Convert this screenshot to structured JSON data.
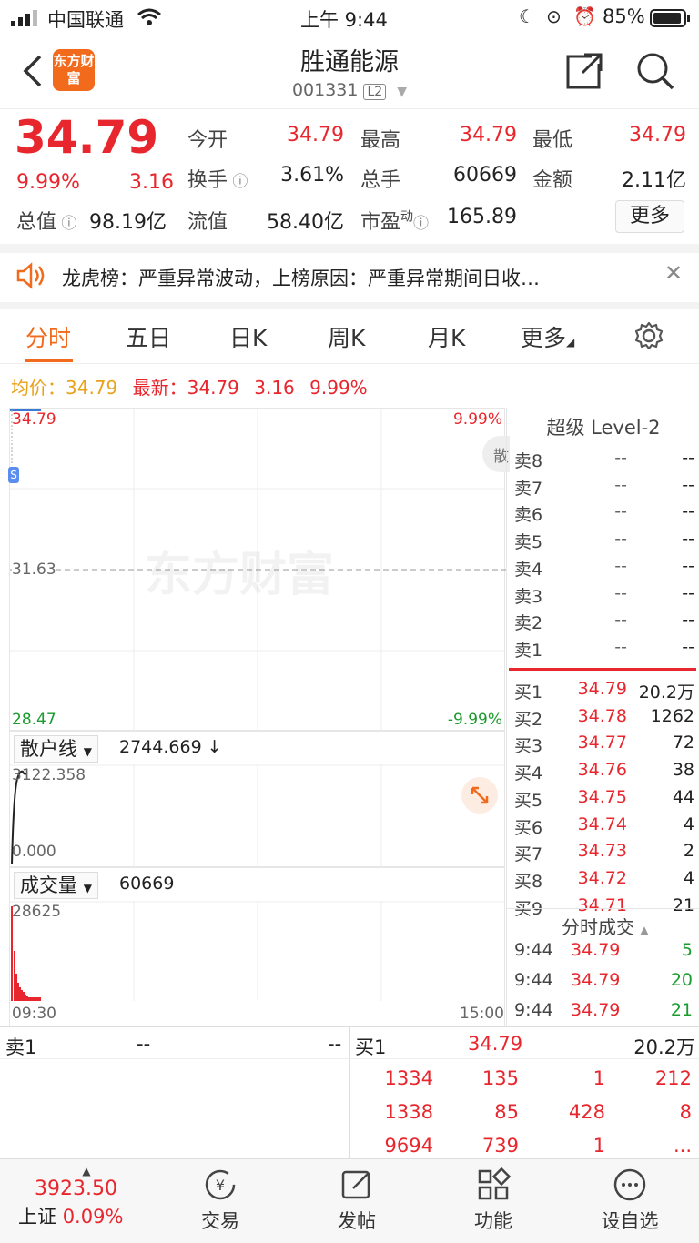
{
  "status_bar": {
    "carrier": "中国联通",
    "time": "上午 9:44",
    "battery": "85%"
  },
  "nav": {
    "logo": "东方财富",
    "title": "胜通能源",
    "code": "001331",
    "level": "L2",
    "back_icon": "back-icon",
    "share_icon": "share-icon",
    "search_icon": "search-icon"
  },
  "quote": {
    "price": "34.79",
    "change_pct": "9.99%",
    "change": "3.16",
    "open_label": "今开",
    "open": "34.79",
    "high_label": "最高",
    "high": "34.79",
    "low_label": "最低",
    "low": "34.79",
    "turnover_label": "换手",
    "turnover": "3.61%",
    "volume_label": "总手",
    "volume": "60669",
    "amount_label": "金额",
    "amount": "2.11亿",
    "mktcap_label": "总值",
    "mktcap": "98.19亿",
    "float_label": "流值",
    "float_cap": "58.40亿",
    "pe_label": "市盈",
    "pe_sup": "动",
    "pe": "165.89",
    "more": "更多"
  },
  "notice": {
    "text": "龙虎榜：严重异常波动，上榜原因：严重异常期间日收…"
  },
  "tabs": [
    "分时",
    "五日",
    "日K",
    "周K",
    "月K",
    "更多"
  ],
  "info_line": {
    "avg_label": "均价：",
    "avg": "34.79",
    "last_label": "最新：",
    "last": "34.79",
    "chg": "3.16",
    "pct": "9.99%"
  },
  "chart": {
    "upper_price": "34.79",
    "upper_pct": "9.99%",
    "mid_price": "31.63",
    "lower_price": "28.47",
    "lower_pct": "-9.99%",
    "watermark": "东方财富",
    "side_tab": "散"
  },
  "retail_line": {
    "label": "散户线",
    "value": "2744.669 ↓",
    "max": "3122.358",
    "min": "0.000"
  },
  "volume_panel": {
    "label": "成交量",
    "value": "60669",
    "max": "28625",
    "start": "09:30",
    "end": "15:00"
  },
  "book": {
    "title": "超级 Level-2",
    "asks": [
      {
        "label": "卖8",
        "price": "--",
        "vol": "--"
      },
      {
        "label": "卖7",
        "price": "--",
        "vol": "--"
      },
      {
        "label": "卖6",
        "price": "--",
        "vol": "--"
      },
      {
        "label": "卖5",
        "price": "--",
        "vol": "--"
      },
      {
        "label": "卖4",
        "price": "--",
        "vol": "--"
      },
      {
        "label": "卖3",
        "price": "--",
        "vol": "--"
      },
      {
        "label": "卖2",
        "price": "--",
        "vol": "--"
      },
      {
        "label": "卖1",
        "price": "--",
        "vol": "--"
      }
    ],
    "bids": [
      {
        "label": "买1",
        "price": "34.79",
        "vol": "20.2万"
      },
      {
        "label": "买2",
        "price": "34.78",
        "vol": "1262"
      },
      {
        "label": "买3",
        "price": "34.77",
        "vol": "72"
      },
      {
        "label": "买4",
        "price": "34.76",
        "vol": "38"
      },
      {
        "label": "买5",
        "price": "34.75",
        "vol": "44"
      },
      {
        "label": "买6",
        "price": "34.74",
        "vol": "4"
      },
      {
        "label": "买7",
        "price": "34.73",
        "vol": "2"
      },
      {
        "label": "买8",
        "price": "34.72",
        "vol": "4"
      },
      {
        "label": "买9",
        "price": "34.71",
        "vol": "21"
      }
    ]
  },
  "ticks": {
    "title": "分时成交",
    "rows": [
      {
        "time": "9:44",
        "price": "34.79",
        "vol": "5"
      },
      {
        "time": "9:44",
        "price": "34.79",
        "vol": "20"
      },
      {
        "time": "9:44",
        "price": "34.79",
        "vol": "21"
      }
    ]
  },
  "queue": {
    "sell_label": "卖1",
    "sell_price": "--",
    "sell_vol": "--",
    "buy_label": "买1",
    "buy_price": "34.79",
    "buy_vol": "20.2万",
    "rows": [
      [
        "1334",
        "135",
        "1",
        "212"
      ],
      [
        "1338",
        "85",
        "428",
        "8"
      ],
      [
        "9694",
        "739",
        "1",
        "..."
      ]
    ]
  },
  "bottom_bar": {
    "index_value": "3923.50",
    "index_name": "上证",
    "index_pct": "0.09%",
    "items": [
      "交易",
      "发帖",
      "功能",
      "设自选"
    ]
  }
}
